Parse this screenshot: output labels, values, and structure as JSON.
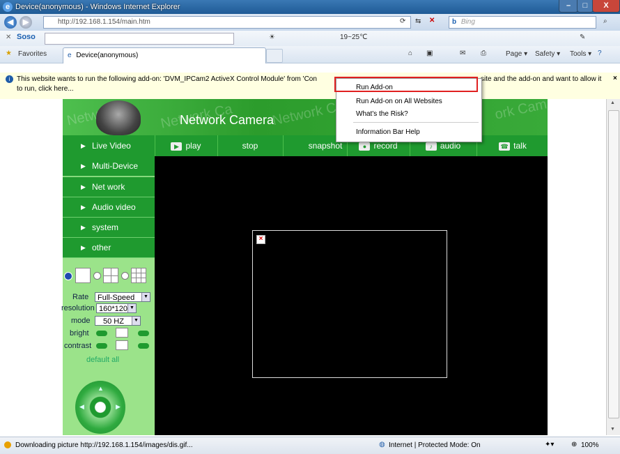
{
  "window": {
    "title": "Device(anonymous) - Windows Internet Explorer",
    "address": "http://192.168.1.154/main.htm",
    "search_placeholder": "Bing",
    "buttons": {
      "minimize": "–",
      "maximize": "□",
      "close": "X"
    }
  },
  "soso_bar": {
    "brand": "Soso",
    "weather": "19~25℃"
  },
  "favorites_bar": {
    "favorites_label": "Favorites",
    "tab_title": "Device(anonymous)",
    "page_label": "Page ▾",
    "safety_label": "Safety ▾",
    "tools_label": "Tools ▾"
  },
  "info_bar": {
    "text_before": "This website wants to run the following add-on: 'DVM_IPCam2 ActiveX Control Module' from 'Con",
    "text_after": "site and the add-on and want to allow it",
    "line2": "to run, click here..."
  },
  "context_menu": {
    "items": [
      "Run Add-on",
      "Run Add-on on All Websites",
      "What's the Risk?",
      "Information Bar Help"
    ]
  },
  "camera_page": {
    "header_title": "Network Camera",
    "toolbar": [
      "play",
      "stop",
      "snapshot",
      "record",
      "audio",
      "talk"
    ],
    "menu": [
      "Live Video",
      "Multi-Device",
      "Net work",
      "Audio video",
      "system",
      "other"
    ],
    "controls": {
      "rate_label": "Rate",
      "rate_value": "Full-Speed",
      "resolution_label": "resolution",
      "resolution_value": "160*120",
      "mode_label": "mode",
      "mode_value": "50 HZ",
      "bright_label": "bright",
      "contrast_label": "contrast",
      "default_all": "default all"
    }
  },
  "status_bar": {
    "text": "Downloading picture http://192.168.1.154/images/dis.gif...",
    "zone": "Internet | Protected Mode: On",
    "zoom": "100%"
  },
  "colors": {
    "green": "#1f9a2f",
    "light_green": "#9be38a",
    "highlight": "#e02020",
    "info_bar": "#ffffe1"
  }
}
